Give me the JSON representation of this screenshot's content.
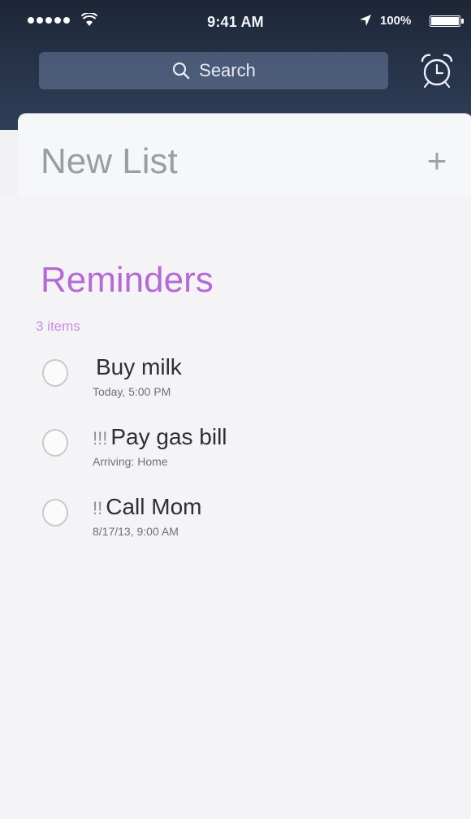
{
  "status_bar": {
    "time": "9:41 AM",
    "battery": "100%"
  },
  "search": {
    "placeholder": "Search"
  },
  "new_list": {
    "title": "New List",
    "add_symbol": "+"
  },
  "list": {
    "title": "Reminders",
    "count": "3 items",
    "accent_color": "#b56ad4",
    "items": [
      {
        "priority": "",
        "title": "Buy milk",
        "meta": "Today, 5:00 PM",
        "completed": false
      },
      {
        "priority": "!!!",
        "title": "Pay gas bill",
        "meta": "Arriving: Home",
        "completed": false
      },
      {
        "priority": "!!",
        "title": "Call Mom",
        "meta": "8/17/13, 9:00 AM",
        "completed": false
      }
    ]
  },
  "icons": {
    "signal": "cellular-dots-icon",
    "wifi": "wifi-icon",
    "location": "location-arrow-icon",
    "battery": "battery-icon",
    "search": "magnifier-icon",
    "alarm": "alarm-clock-icon"
  }
}
